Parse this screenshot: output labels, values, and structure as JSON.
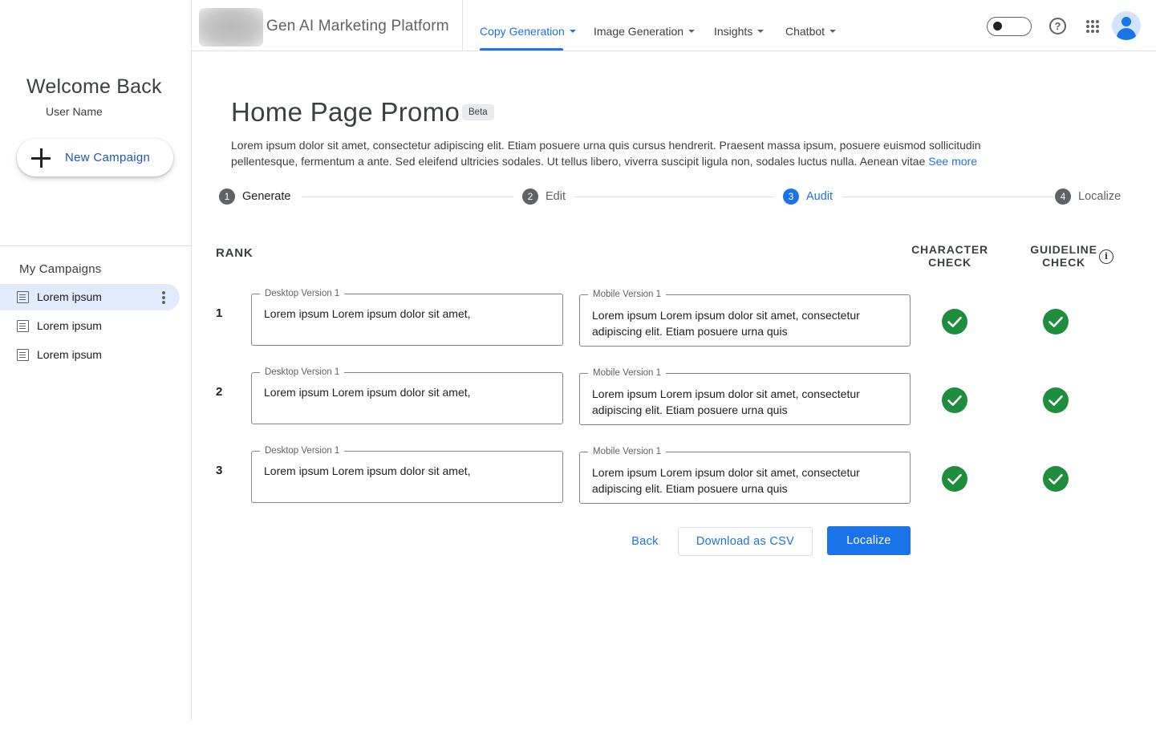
{
  "sidebar": {
    "welcome": "Welcome Back",
    "user_name": "User Name",
    "new_campaign_label": "New Campaign",
    "section_title": "My Campaigns",
    "campaigns": [
      {
        "label": "Lorem ipsum",
        "active": true
      },
      {
        "label": "Lorem ipsum",
        "active": false
      },
      {
        "label": "Lorem ipsum",
        "active": false
      }
    ]
  },
  "header": {
    "app_title": "Gen AI Marketing Platform",
    "nav": [
      {
        "label": "Copy Generation",
        "active": true
      },
      {
        "label": "Image Generation",
        "active": false
      },
      {
        "label": "Insights",
        "active": false
      },
      {
        "label": "Chatbot",
        "active": false
      }
    ],
    "icons": [
      "toggle-switch",
      "help-icon",
      "apps-grid-icon",
      "avatar-icon"
    ]
  },
  "main": {
    "title": "Home Page Promo",
    "badge": "Beta",
    "description": "Lorem ipsum dolor sit amet, consectetur adipiscing elit. Etiam posuere urna quis cursus hendrerit. Praesent massa ipsum, posuere euismod sollicitudin pellentesque, fermentum a ante. Sed eleifend ultricies sodales. Ut tellus libero, viverra suscipit ligula non, sodales luctus nulla. Aenean vitae",
    "see_more": "See more",
    "steps": [
      {
        "num": "1",
        "label": "Generate",
        "state": "done"
      },
      {
        "num": "2",
        "label": "Edit",
        "state": "todo"
      },
      {
        "num": "3",
        "label": "Audit",
        "state": "current"
      },
      {
        "num": "4",
        "label": "Localize",
        "state": "todo"
      }
    ],
    "table": {
      "rank_header": "RANK",
      "character_check_header": "CHARACTER CHECK",
      "guideline_check_header": "GUIDELINE CHECK",
      "rows": [
        {
          "rank": "1",
          "desktop_label": "Desktop Version 1",
          "desktop_text": "Lorem ipsum Lorem ipsum dolor sit amet,",
          "mobile_label": "Mobile Version 1",
          "mobile_text": "Lorem ipsum Lorem ipsum dolor sit amet, consectetur adipiscing elit. Etiam posuere urna quis",
          "character_ok": true,
          "guideline_ok": true
        },
        {
          "rank": "2",
          "desktop_label": "Desktop Version 1",
          "desktop_text": "Lorem ipsum Lorem ipsum dolor sit amet,",
          "mobile_label": "Mobile Version 1",
          "mobile_text": "Lorem ipsum Lorem ipsum dolor sit amet, consectetur adipiscing elit. Etiam posuere urna quis",
          "character_ok": true,
          "guideline_ok": true
        },
        {
          "rank": "3",
          "desktop_label": "Desktop Version 1",
          "desktop_text": "Lorem ipsum Lorem ipsum dolor sit amet,",
          "mobile_label": "Mobile Version 1",
          "mobile_text": "Lorem ipsum Lorem ipsum dolor sit amet, consectetur adipiscing elit. Etiam posuere urna quis",
          "character_ok": true,
          "guideline_ok": true
        }
      ]
    },
    "actions": {
      "back": "Back",
      "download_csv": "Download as CSV",
      "localize": "Localize"
    }
  },
  "colors": {
    "accent": "#1a73e8",
    "success": "#1e8e3e",
    "active_item_bg": "#e2ebfb"
  }
}
